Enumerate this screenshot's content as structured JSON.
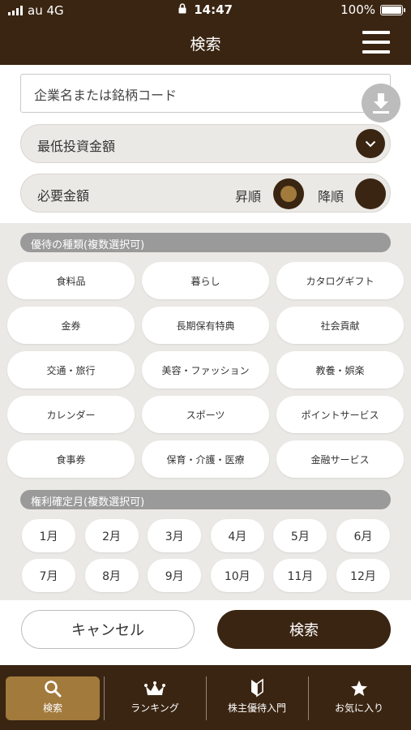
{
  "status_bar": {
    "carrier": "au 4G",
    "time": "14:47",
    "battery": "100%"
  },
  "header": {
    "title": "検索"
  },
  "company_field": {
    "placeholder": "企業名または銘柄コード"
  },
  "min_investment": {
    "label": "最低投資金額"
  },
  "required_amount": {
    "label": "必要金額",
    "asc_label": "昇順",
    "desc_label": "降順",
    "selected": "昇順"
  },
  "benefit_types": {
    "header": "優待の種類(複数選択可)",
    "items": [
      "食料品",
      "暮らし",
      "カタログギフト",
      "金券",
      "長期保有特典",
      "社会貢献",
      "交通・旅行",
      "美容・ファッション",
      "教養・娯楽",
      "カレンダー",
      "スポーツ",
      "ポイントサービス",
      "食事券",
      "保育・介護・医療",
      "金融サービス"
    ]
  },
  "rights_months": {
    "header": "権利確定月(複数選択可)",
    "items": [
      "1月",
      "2月",
      "3月",
      "4月",
      "5月",
      "6月",
      "7月",
      "8月",
      "9月",
      "10月",
      "11月",
      "12月"
    ]
  },
  "actions": {
    "cancel": "キャンセル",
    "search": "検索"
  },
  "bottom_nav": {
    "items": [
      {
        "label": "検索",
        "icon": "search-icon",
        "active": true
      },
      {
        "label": "ランキング",
        "icon": "crown-icon",
        "active": false
      },
      {
        "label": "株主優待入門",
        "icon": "beginner-mark-icon",
        "active": false
      },
      {
        "label": "お気に入り",
        "icon": "star-icon",
        "active": false
      }
    ]
  },
  "colors": {
    "primary": "#3a2512",
    "accent": "#a27a3c",
    "panel": "#ebe9e5",
    "section": "#9a9a9a"
  }
}
